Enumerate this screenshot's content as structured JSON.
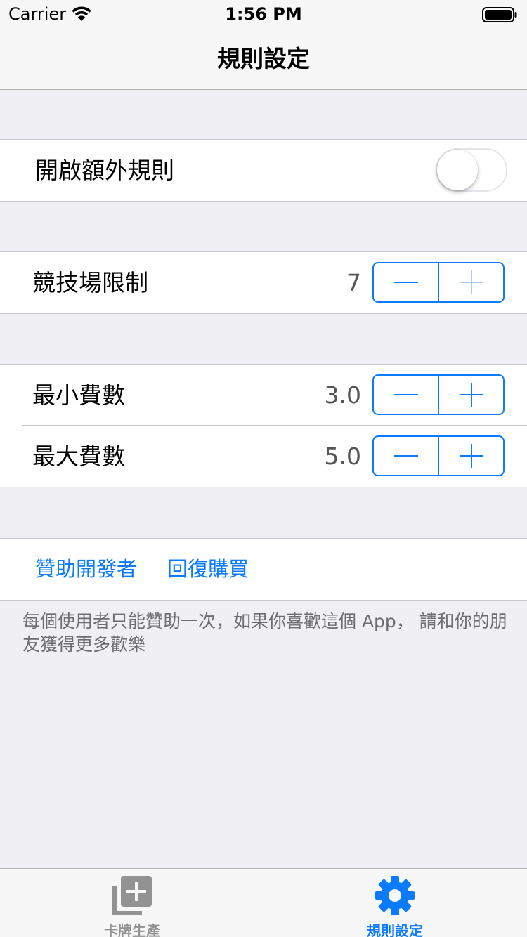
{
  "status_bar": {
    "carrier": "Carrier",
    "time": "1:56 PM"
  },
  "nav": {
    "title": "規則設定"
  },
  "extra_rules": {
    "label": "開啟額外規則",
    "enabled": false
  },
  "arena_limit": {
    "label": "競技場限制",
    "value": "7"
  },
  "min_cost": {
    "label": "最小費數",
    "value": "3.0"
  },
  "max_cost": {
    "label": "最大費數",
    "value": "5.0"
  },
  "links": {
    "sponsor": "贊助開發者",
    "restore": "回復購買"
  },
  "footer_note": "每個使用者只能贊助一次，如果你喜歡這個 App，  請和你的朋友獲得更多歡樂",
  "tabs": [
    {
      "label": "卡牌生產",
      "icon": "add-card-icon",
      "active": false
    },
    {
      "label": "規則設定",
      "icon": "gear-icon",
      "active": true
    }
  ],
  "colors": {
    "accent": "#0a7aff",
    "inactive": "#929292",
    "background": "#efeff4"
  }
}
